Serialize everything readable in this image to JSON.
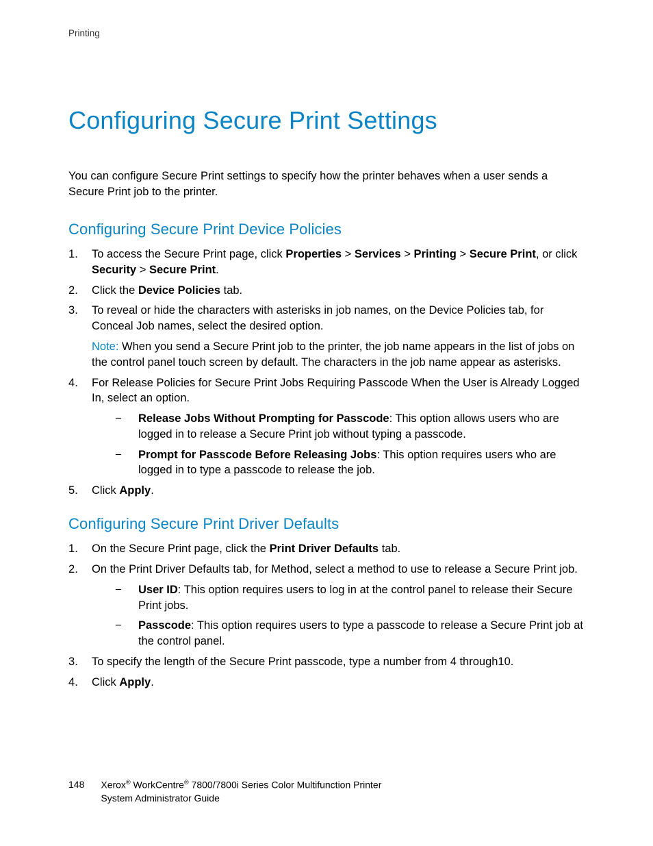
{
  "header": {
    "section": "Printing"
  },
  "title": "Configuring Secure Print Settings",
  "intro": "You can configure Secure Print settings to specify how the printer behaves when a user sends a Secure Print job to the printer.",
  "section1": {
    "heading": "Configuring Secure Print Device Policies",
    "item1_pre": "To access the Secure Print page, click ",
    "item1_b1": "Properties",
    "item1_sep1": " > ",
    "item1_b2": "Services",
    "item1_sep2": " > ",
    "item1_b3": "Printing",
    "item1_sep3": " > ",
    "item1_b4": "Secure Print",
    "item1_mid": ", or click ",
    "item1_b5": "Security",
    "item1_sep4": " > ",
    "item1_b6": "Secure Print",
    "item1_post": ".",
    "item2_pre": "Click the ",
    "item2_b": "Device Policies",
    "item2_post": " tab.",
    "item3_text": "To reveal or hide the characters with asterisks in job names, on the Device Policies tab, for Conceal Job names, select the desired option.",
    "item3_note_label": "Note:",
    "item3_note_text": " When you send a Secure Print job to the printer, the job name appears in the list of jobs on the control panel touch screen by default. The characters in the job name appear as asterisks.",
    "item4_text": "For Release Policies for Secure Print Jobs Requiring Passcode When the User is Already Logged In, select an option.",
    "item4_sub1_b": "Release Jobs Without Prompting for Passcode",
    "item4_sub1_t": ": This option allows users who are logged in to release a Secure Print job without typing a passcode.",
    "item4_sub2_b": "Prompt for Passcode Before Releasing Jobs",
    "item4_sub2_t": ": This option requires users who are logged in to type a passcode to release the job.",
    "item5_pre": "Click ",
    "item5_b": "Apply",
    "item5_post": "."
  },
  "section2": {
    "heading": "Configuring Secure Print Driver Defaults",
    "item1_pre": "On the Secure Print page, click the ",
    "item1_b": "Print Driver Defaults",
    "item1_post": " tab.",
    "item2_text": "On the Print Driver Defaults tab, for Method, select a method to use to release a Secure Print job.",
    "item2_sub1_b": "User ID",
    "item2_sub1_t": ": This option requires users to log in at the control panel to release their Secure Print jobs.",
    "item2_sub2_b": "Passcode",
    "item2_sub2_t": ": This option requires users to type a passcode to release a Secure Print job at the control panel.",
    "item3_text": "To specify the length of the Secure Print passcode, type a number from 4 through10.",
    "item4_pre": "Click ",
    "item4_b": "Apply",
    "item4_post": "."
  },
  "footer": {
    "page": "148",
    "brand": "Xerox",
    "product": " WorkCentre",
    "model": " 7800/7800i Series Color Multifunction Printer",
    "line2": "System Administrator Guide"
  }
}
